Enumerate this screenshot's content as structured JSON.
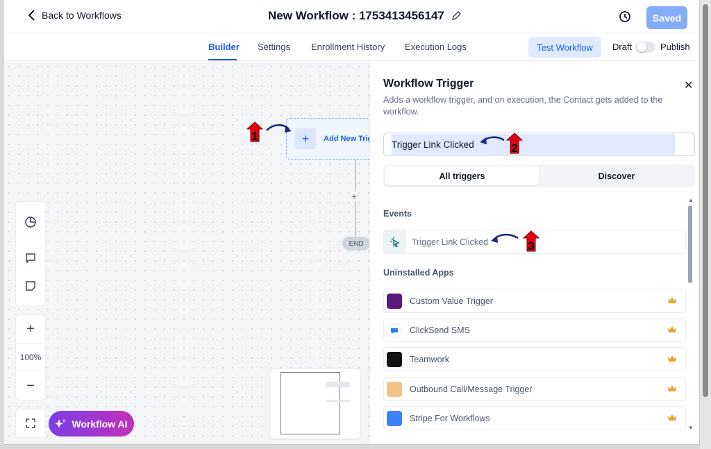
{
  "header": {
    "back_label": "Back to Workflows",
    "title": "New Workflow : 1753413456147",
    "saved_label": "Saved"
  },
  "tabs": [
    "Builder",
    "Settings",
    "Enrollment History",
    "Execution Logs"
  ],
  "active_tab": "Builder",
  "toolbar": {
    "test_label": "Test Workflow",
    "draft_label": "Draft",
    "publish_label": "Publish"
  },
  "canvas": {
    "add_trigger_label": "Add New Trigger",
    "end_label": "END",
    "zoom_level": "100%",
    "ai_label": "Workflow AI"
  },
  "panel": {
    "title": "Workflow Trigger",
    "description": "Adds a workflow trigger, and on execution, the Contact gets added to the workflow.",
    "search_value": "Trigger Link Clicked",
    "seg_tabs": [
      "All triggers",
      "Discover"
    ],
    "events_heading": "Events",
    "event_item": "Trigger Link Clicked",
    "uninstalled_heading": "Uninstalled Apps",
    "apps": [
      {
        "label": "Custom Value Trigger",
        "color": "#5b1a7a"
      },
      {
        "label": "ClickSend SMS",
        "color": "#2f80ed"
      },
      {
        "label": "Teamwork",
        "color": "#111111"
      },
      {
        "label": "Outbound Call/Message Trigger",
        "color": "#f2c288"
      },
      {
        "label": "Stripe For Workflows",
        "color": "#3b82f6"
      }
    ]
  },
  "annotations": [
    "1",
    "2",
    "3"
  ],
  "colors": {
    "accent": "#155eef",
    "annotation_red": "#e3000f",
    "arrow_navy": "#1a2b7a"
  }
}
